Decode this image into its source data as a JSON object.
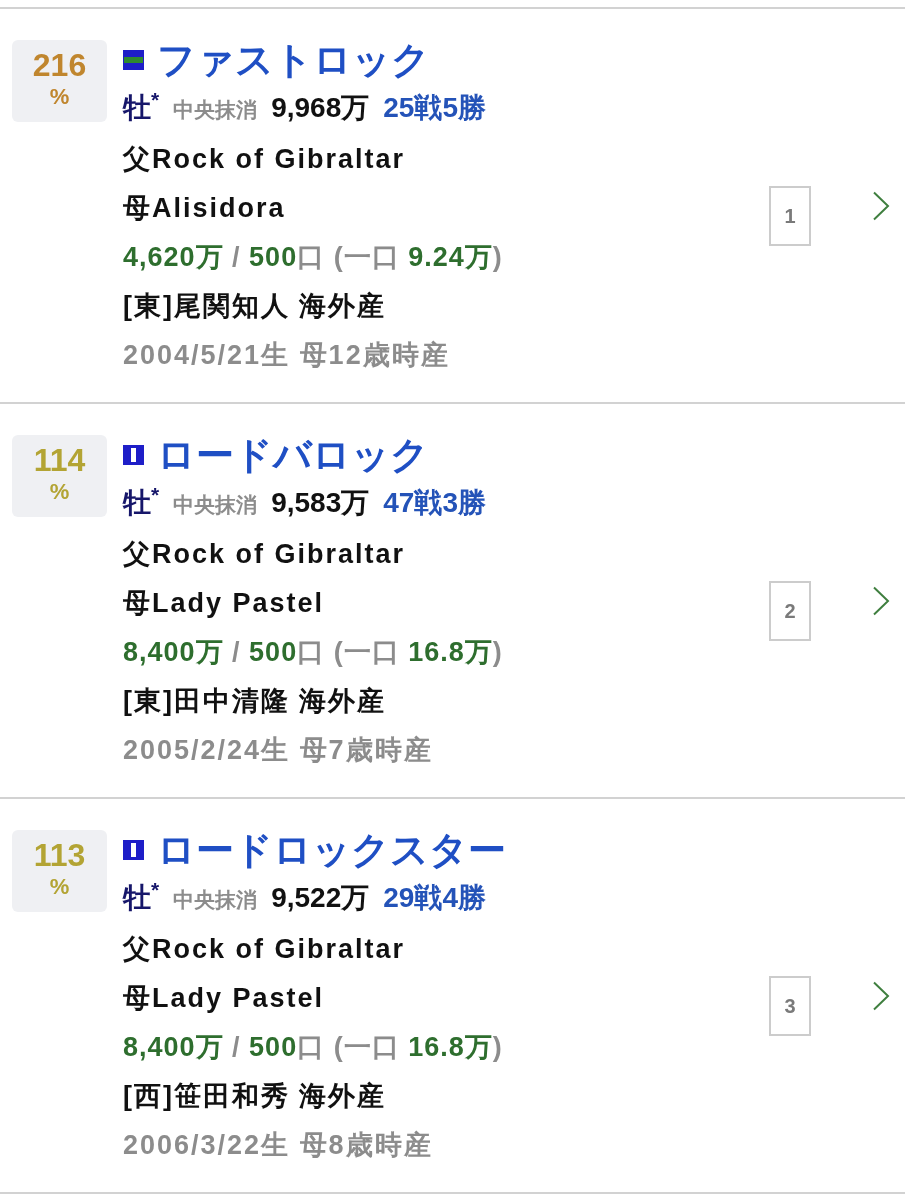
{
  "horses": [
    {
      "percent": "216",
      "percent_unit": "%",
      "color": "#c0862e",
      "silks": {
        "kind": "hoops"
      },
      "name": "ファストロック",
      "sex": "牡$^{*}$",
      "status": "中央抹消",
      "earnings": "9,968万",
      "record": "25戦5勝",
      "sire": "父Rock of Gibraltar",
      "dam": "母Alisidora",
      "price": [
        {
          "kind": "value",
          "text": "4,620万"
        },
        {
          "kind": "unit",
          "text": " / "
        },
        {
          "kind": "value",
          "text": "500"
        },
        {
          "kind": "unit",
          "text": "口 (一口 "
        },
        {
          "kind": "value",
          "text": "9.24万"
        },
        {
          "kind": "unit",
          "text": ")"
        }
      ],
      "trainer": "[東]尾関知人 海外産",
      "birth": "2004/5/21生 母12歳時産",
      "number": "1"
    },
    {
      "percent": "114",
      "percent_unit": "%",
      "color": "#b3a434",
      "silks": {
        "kind": "stripe"
      },
      "name": "ロードバロック",
      "sex": "牡$^{*}$",
      "status": "中央抹消",
      "earnings": "9,583万",
      "record": "47戦3勝",
      "sire": "父Rock of Gibraltar",
      "dam": "母Lady Pastel",
      "price": [
        {
          "kind": "value",
          "text": "8,400万"
        },
        {
          "kind": "unit",
          "text": " / "
        },
        {
          "kind": "value",
          "text": "500"
        },
        {
          "kind": "unit",
          "text": "口 (一口 "
        },
        {
          "kind": "value",
          "text": "16.8万"
        },
        {
          "kind": "unit",
          "text": ")"
        }
      ],
      "trainer": "[東]田中清隆 海外産",
      "birth": "2005/2/24生 母7歳時産",
      "number": "2"
    },
    {
      "percent": "113",
      "percent_unit": "%",
      "color": "#b3a434",
      "silks": {
        "kind": "stripe"
      },
      "name": "ロードロックスター",
      "sex": "牡$^{*}$",
      "status": "中央抹消",
      "earnings": "9,522万",
      "record": "29戦4勝",
      "sire": "父Rock of Gibraltar",
      "dam": "母Lady Pastel",
      "price": [
        {
          "kind": "value",
          "text": "8,400万"
        },
        {
          "kind": "unit",
          "text": " / "
        },
        {
          "kind": "value",
          "text": "500"
        },
        {
          "kind": "unit",
          "text": "口 (一口 "
        },
        {
          "kind": "value",
          "text": "16.8万"
        },
        {
          "kind": "unit",
          "text": ")"
        }
      ],
      "trainer": "[西]笹田和秀 海外産",
      "birth": "2006/3/22生 母8歳時産",
      "number": "3"
    }
  ]
}
